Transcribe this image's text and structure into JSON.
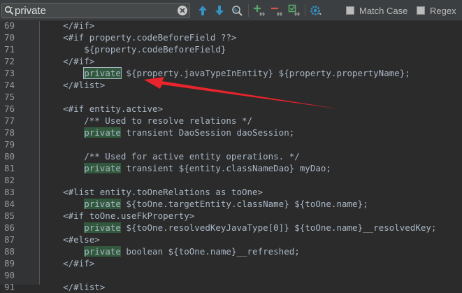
{
  "search": {
    "value": "private",
    "match_case_label": "Match Case",
    "regex_label": "Regex"
  },
  "icons": {
    "search": "search-icon",
    "clear": "clear-icon",
    "prev": "arrow-up-icon",
    "next": "arrow-down-icon",
    "find_usages": "find-usages-icon",
    "add_occurrence": "add-occurrence-icon",
    "remove_occurrence": "remove-occurrence-icon",
    "select_all": "select-all-occurrences-icon",
    "settings": "settings-icon"
  },
  "colors": {
    "accent_blue": "#3592c4",
    "accent_green": "#59a869",
    "accent_red": "#d9534f",
    "arrow_red": "#e8242c",
    "highlight": "#32593d"
  },
  "editor": {
    "lines": [
      {
        "num": "69",
        "text": "    </#if>",
        "match": ""
      },
      {
        "num": "70",
        "text": "    <#if property.codeBeforeField ??>",
        "match": ""
      },
      {
        "num": "71",
        "text": "        ${property.codeBeforeField}",
        "match": ""
      },
      {
        "num": "72",
        "text": "    </#if>",
        "match": ""
      },
      {
        "num": "73",
        "text": "        ",
        "match": "private",
        "rest": " ${property.javaTypeInEntity} ${property.propertyName};",
        "active": true
      },
      {
        "num": "74",
        "text": "    </#list>",
        "match": ""
      },
      {
        "num": "75",
        "text": "",
        "match": ""
      },
      {
        "num": "76",
        "text": "    <#if entity.active>",
        "match": ""
      },
      {
        "num": "77",
        "text": "        /** Used to resolve relations */",
        "match": ""
      },
      {
        "num": "78",
        "text": "        ",
        "match": "private",
        "rest": " transient DaoSession daoSession;"
      },
      {
        "num": "79",
        "text": "",
        "match": ""
      },
      {
        "num": "80",
        "text": "        /** Used for active entity operations. */",
        "match": ""
      },
      {
        "num": "81",
        "text": "        ",
        "match": "private",
        "rest": " transient ${entity.classNameDao} myDao;"
      },
      {
        "num": "82",
        "text": "",
        "match": ""
      },
      {
        "num": "83",
        "text": "    <#list entity.toOneRelations as toOne>",
        "match": ""
      },
      {
        "num": "84",
        "text": "        ",
        "match": "private",
        "rest": " ${toOne.targetEntity.className} ${toOne.name};"
      },
      {
        "num": "85",
        "text": "    <#if toOne.useFkProperty>",
        "match": ""
      },
      {
        "num": "86",
        "text": "        ",
        "match": "private",
        "rest": " ${toOne.resolvedKeyJavaType[0]} ${toOne.name}__resolvedKey;"
      },
      {
        "num": "87",
        "text": "    <#else>",
        "match": ""
      },
      {
        "num": "88",
        "text": "        ",
        "match": "private",
        "rest": " boolean ${toOne.name}__refreshed;"
      },
      {
        "num": "89",
        "text": "    </#if>",
        "match": ""
      },
      {
        "num": "90",
        "text": "",
        "match": ""
      },
      {
        "num": "91",
        "text": "    </#list>",
        "match": ""
      }
    ]
  }
}
